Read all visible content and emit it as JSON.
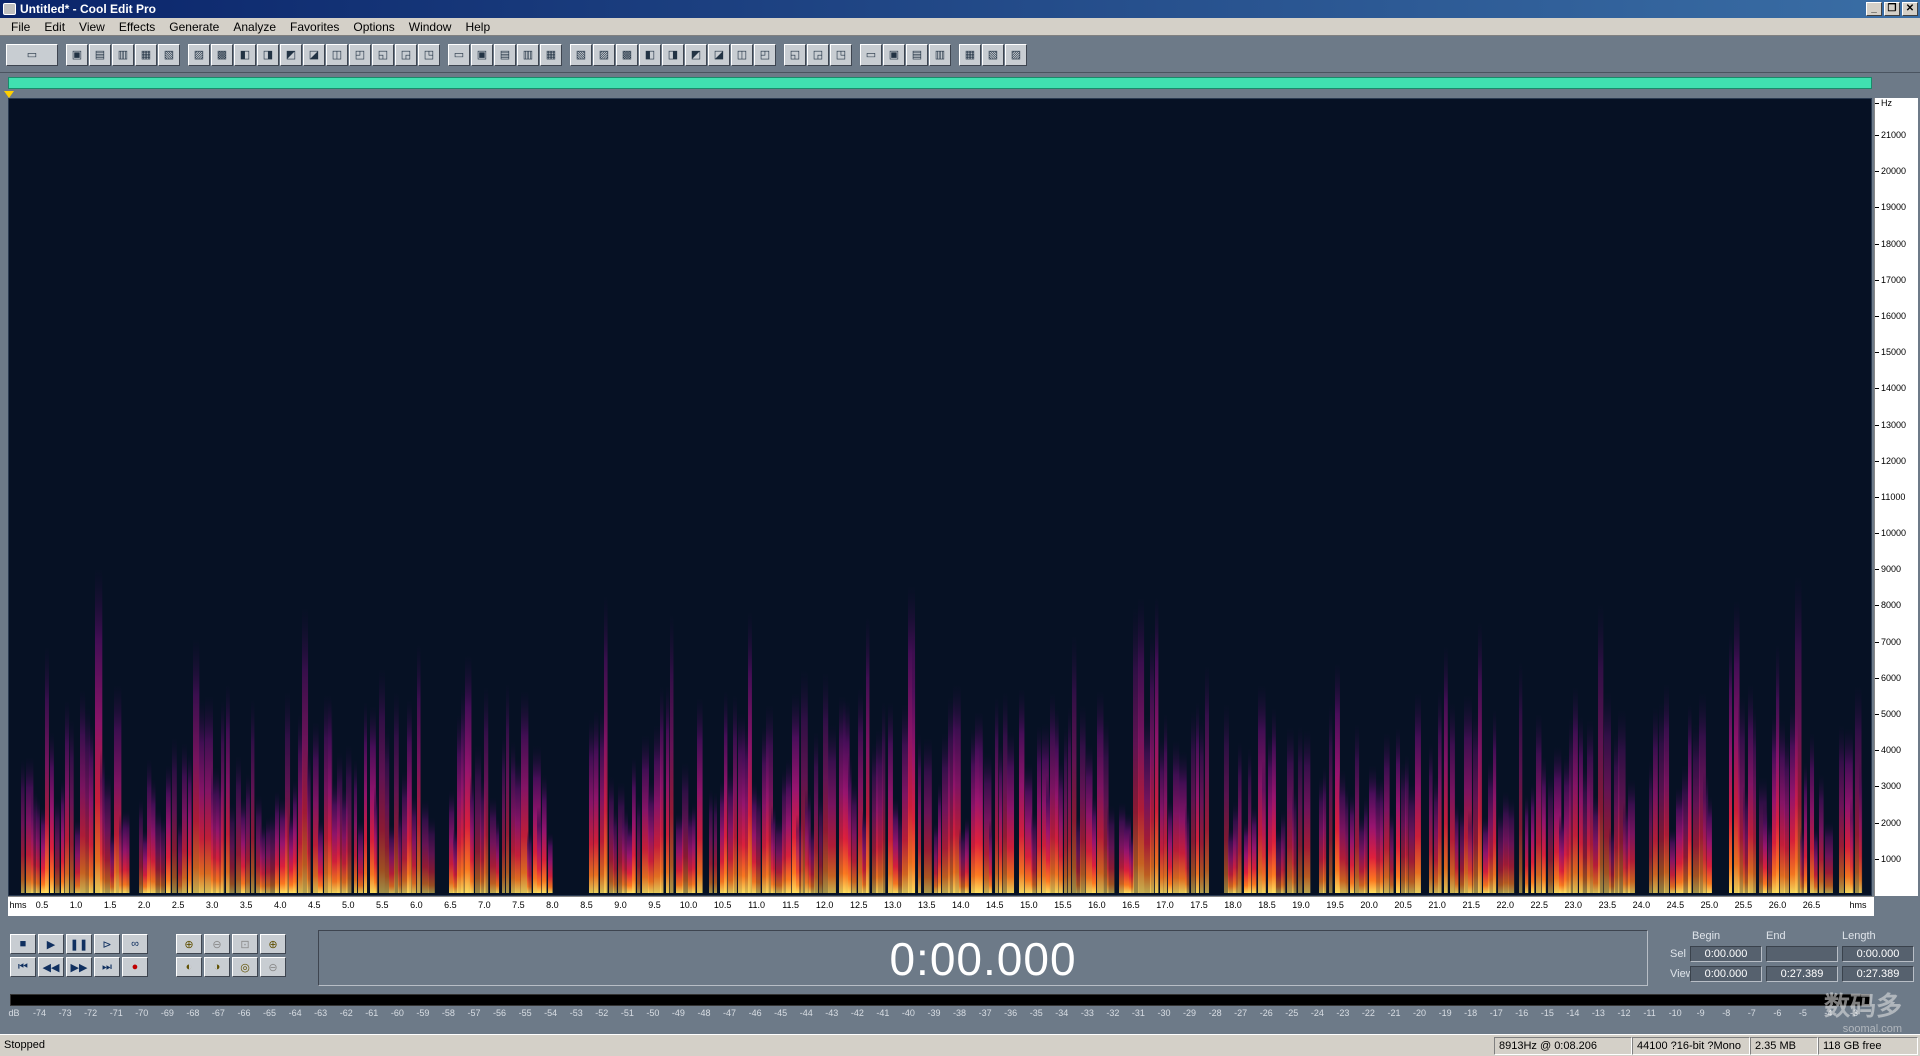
{
  "window": {
    "title": "Untitled* - Cool Edit Pro",
    "minimize": "_",
    "restore": "❐",
    "close": "✕"
  },
  "menu": [
    "File",
    "Edit",
    "View",
    "Effects",
    "Generate",
    "Analyze",
    "Favorites",
    "Options",
    "Window",
    "Help"
  ],
  "toolbar_groups": [
    [
      "waveform-view-icon"
    ],
    [
      "new-icon",
      "open-icon",
      "save-icon",
      "save-as-icon",
      "close-file-icon"
    ],
    [
      "undo-icon",
      "redo-icon",
      "cut-icon",
      "copy-icon",
      "paste-icon",
      "mix-paste-icon",
      "trim-icon",
      "silence-icon",
      "insert-icon",
      "clipboard-icon",
      "find-icon"
    ],
    [
      "envelope-icon",
      "normalize-icon",
      "channel-icon",
      "noise-icon",
      "fade-icon"
    ],
    [
      "region-icon",
      "cue-icon",
      "marker-icon",
      "play-list-icon",
      "zoom-icon",
      "bpm-icon",
      "grid-icon",
      "meter-icon",
      "spectral-icon"
    ],
    [
      "settings-icon",
      "cd-icon",
      "help-icon"
    ],
    [
      "script-icon",
      "batch-icon",
      "pitch-icon",
      "stretch-icon"
    ],
    [
      "analyze-icon",
      "phase-icon",
      "fullscreen-icon"
    ]
  ],
  "y_axis": {
    "unit": "Hz",
    "ticks": [
      "21000",
      "20000",
      "19000",
      "18000",
      "17000",
      "16000",
      "15000",
      "14000",
      "13000",
      "12000",
      "11000",
      "10000",
      "9000",
      "8000",
      "7000",
      "6000",
      "5000",
      "4000",
      "3000",
      "2000",
      "1000"
    ]
  },
  "x_axis": {
    "unit_left": "hms",
    "unit_right": "hms",
    "ticks": [
      "0.5",
      "1.0",
      "1.5",
      "2.0",
      "2.5",
      "3.0",
      "3.5",
      "4.0",
      "4.5",
      "5.0",
      "5.5",
      "6.0",
      "6.5",
      "7.0",
      "7.5",
      "8.0",
      "8.5",
      "9.0",
      "9.5",
      "10.0",
      "10.5",
      "11.0",
      "11.5",
      "12.0",
      "12.5",
      "13.0",
      "13.5",
      "14.0",
      "14.5",
      "15.0",
      "15.5",
      "16.0",
      "16.5",
      "17.0",
      "17.5",
      "18.0",
      "18.5",
      "19.0",
      "19.5",
      "20.0",
      "20.5",
      "21.0",
      "21.5",
      "22.0",
      "22.5",
      "23.0",
      "23.5",
      "24.0",
      "24.5",
      "25.0",
      "25.5",
      "26.0",
      "26.5"
    ]
  },
  "transport": {
    "row1": [
      {
        "name": "stop-button",
        "icon": "■"
      },
      {
        "name": "play-button",
        "icon": "▶"
      },
      {
        "name": "pause-button",
        "icon": "❚❚"
      },
      {
        "name": "play-to-end-button",
        "icon": "⊳"
      },
      {
        "name": "loop-button",
        "icon": "∞"
      }
    ],
    "row2": [
      {
        "name": "go-to-start-button",
        "icon": "⏮"
      },
      {
        "name": "rewind-button",
        "icon": "◀◀"
      },
      {
        "name": "fast-forward-button",
        "icon": "▶▶"
      },
      {
        "name": "go-to-end-button",
        "icon": "⏭"
      },
      {
        "name": "record-button",
        "icon": "●"
      }
    ]
  },
  "zoom_controls": {
    "row1": [
      {
        "name": "zoom-in-horizontal-button",
        "icon": "⊕",
        "enabled": true
      },
      {
        "name": "zoom-out-horizontal-button",
        "icon": "⊖",
        "enabled": false
      },
      {
        "name": "zoom-out-full-button",
        "icon": "⊡",
        "enabled": false
      },
      {
        "name": "zoom-in-vertical-button",
        "icon": "⊕",
        "enabled": true
      }
    ],
    "row2": [
      {
        "name": "zoom-to-left-button",
        "icon": "◐",
        "enabled": true
      },
      {
        "name": "zoom-to-right-button",
        "icon": "◑",
        "enabled": true
      },
      {
        "name": "zoom-selection-button",
        "icon": "◎",
        "enabled": true
      },
      {
        "name": "zoom-out-vertical-button",
        "icon": "⊖",
        "enabled": false
      }
    ]
  },
  "time_display": "0:00.000",
  "selection": {
    "headers": {
      "begin": "Begin",
      "end": "End",
      "length": "Length"
    },
    "sel_label": "Sel",
    "view_label": "View",
    "sel": {
      "begin": "0:00.000",
      "end": "",
      "length": "0:00.000"
    },
    "view": {
      "begin": "0:00.000",
      "end": "0:27.389",
      "length": "0:27.389"
    }
  },
  "level_meter": {
    "ticks": [
      "dB",
      "-74",
      "-73",
      "-72",
      "-71",
      "-70",
      "-69",
      "-68",
      "-67",
      "-66",
      "-65",
      "-64",
      "-63",
      "-62",
      "-61",
      "-60",
      "-59",
      "-58",
      "-57",
      "-56",
      "-55",
      "-54",
      "-53",
      "-52",
      "-51",
      "-50",
      "-49",
      "-48",
      "-47",
      "-46",
      "-45",
      "-44",
      "-43",
      "-42",
      "-41",
      "-40",
      "-39",
      "-38",
      "-37",
      "-36",
      "-35",
      "-34",
      "-33",
      "-32",
      "-31",
      "-30",
      "-29",
      "-28",
      "-27",
      "-26",
      "-25",
      "-24",
      "-23",
      "-22",
      "-21",
      "-20",
      "-19",
      "-18",
      "-17",
      "-16",
      "-15",
      "-14",
      "-13",
      "-12",
      "-11",
      "-10",
      "-9",
      "-8",
      "-7",
      "-6",
      "-5",
      "-4",
      "-3"
    ]
  },
  "watermark": {
    "line1": "数码多",
    "line2": "soomal.com"
  },
  "status": {
    "state": "Stopped",
    "cursor": "8913Hz @  0:08.206",
    "format": "44100 ?16-bit ?Mono",
    "size": "2.35 MB",
    "free": "118 GB free"
  },
  "colors": {
    "overview": "#40e0b0",
    "spectrogram_bg": "#061124",
    "ui_bg": "#6d7a88"
  }
}
